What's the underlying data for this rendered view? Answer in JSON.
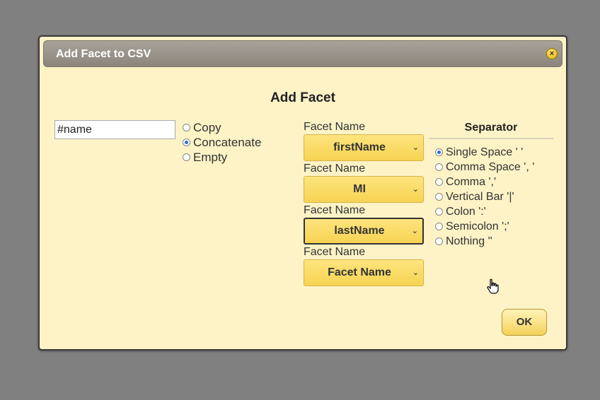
{
  "dialog": {
    "title": "Add Facet to CSV",
    "close_symbol": "×",
    "heading": "Add Facet"
  },
  "name_input": {
    "value": "#name"
  },
  "modes": [
    {
      "label": "Copy",
      "checked": false
    },
    {
      "label": "Concatenate",
      "checked": true
    },
    {
      "label": "Empty",
      "checked": false
    }
  ],
  "facets": [
    {
      "label": "Facet Name",
      "value": "firstName"
    },
    {
      "label": "Facet Name",
      "value": "MI"
    },
    {
      "label": "Facet Name",
      "value": "lastName"
    },
    {
      "label": "Facet Name",
      "value": "Facet Name"
    }
  ],
  "separator": {
    "heading": "Separator",
    "options": [
      {
        "label": "Single Space ' '",
        "checked": true
      },
      {
        "label": "Comma Space ', '",
        "checked": false
      },
      {
        "label": "Comma ','",
        "checked": false
      },
      {
        "label": "Vertical Bar '|'",
        "checked": false
      },
      {
        "label": "Colon ':'",
        "checked": false
      },
      {
        "label": "Semicolon ';'",
        "checked": false
      },
      {
        "label": "Nothing ''",
        "checked": false
      }
    ]
  },
  "ok_label": "OK",
  "icons": {
    "close": "close-icon",
    "chevron": "chevron-down-icon",
    "cursor": "hand-pointer-icon"
  },
  "colors": {
    "dialog_bg": "#fdf3c6",
    "select_bg": "#f7d352",
    "radio_accent": "#2a6fd6"
  }
}
